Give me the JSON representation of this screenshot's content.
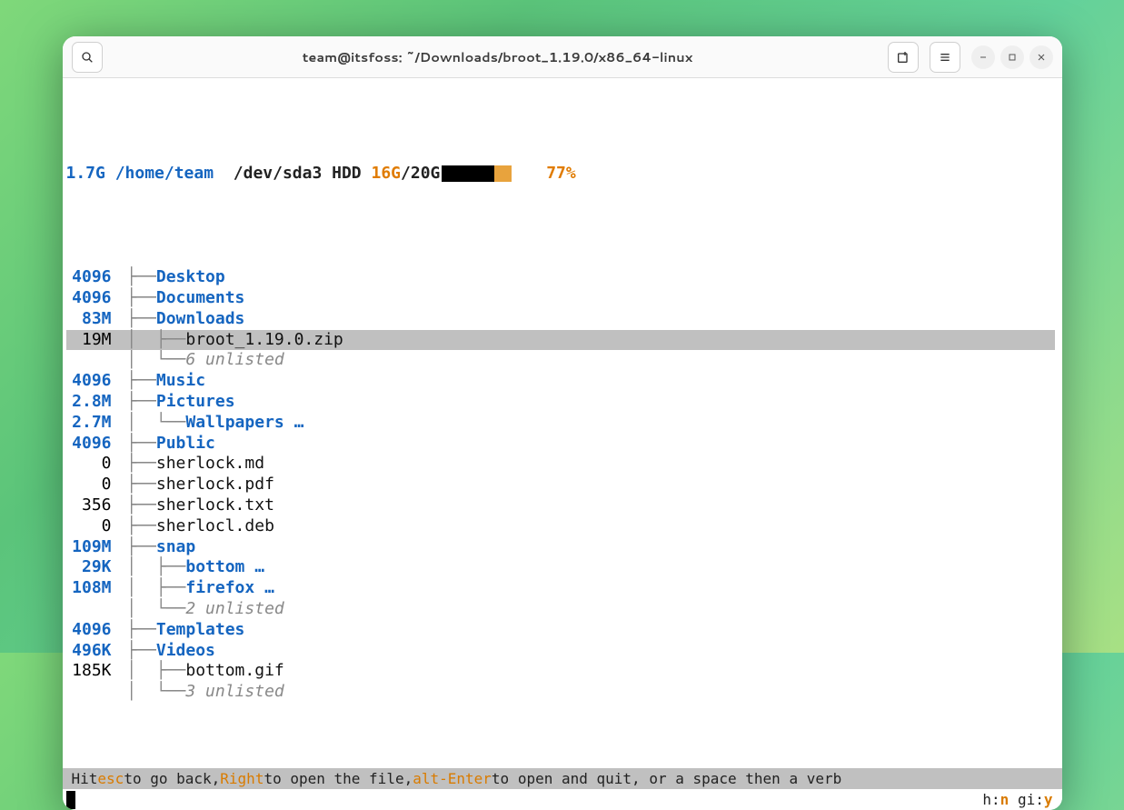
{
  "window": {
    "title": "team@itsfoss: ~/Downloads/broot_1.19.0/x86_64-linux"
  },
  "header": {
    "root_size": "1.7G",
    "root_path": "/home/team",
    "device": "/dev/sda3 HDD",
    "disk_used": "16G",
    "disk_sep": "/",
    "disk_total": "20G",
    "percent": "77%",
    "bar_used_pct": 58,
    "bar_warn_pct": 19
  },
  "tree": [
    {
      "size": "4096",
      "size_style": "blue",
      "tree": "├──",
      "name": "Desktop",
      "kind": "dir"
    },
    {
      "size": "4096",
      "size_style": "blue",
      "tree": "├──",
      "name": "Documents",
      "kind": "dir"
    },
    {
      "size": "83M",
      "size_style": "blue",
      "tree": "├──",
      "name": "Downloads",
      "kind": "dir"
    },
    {
      "size": "19M",
      "size_style": "plain",
      "tree": "│  ├──",
      "name": "broot_1.19.0.zip",
      "kind": "file",
      "selected": true
    },
    {
      "size": "",
      "size_style": "plain",
      "tree": "│  └──",
      "name": "6 unlisted",
      "kind": "unlisted"
    },
    {
      "size": "4096",
      "size_style": "blue",
      "tree": "├──",
      "name": "Music",
      "kind": "dir"
    },
    {
      "size": "2.8M",
      "size_style": "blue",
      "tree": "├──",
      "name": "Pictures",
      "kind": "dir"
    },
    {
      "size": "2.7M",
      "size_style": "blue",
      "tree": "│  └──",
      "name": "Wallpapers …",
      "kind": "dir"
    },
    {
      "size": "4096",
      "size_style": "blue",
      "tree": "├──",
      "name": "Public",
      "kind": "dir"
    },
    {
      "size": "0",
      "size_style": "plain",
      "tree": "├──",
      "name": "sherlock.md",
      "kind": "file"
    },
    {
      "size": "0",
      "size_style": "plain",
      "tree": "├──",
      "name": "sherlock.pdf",
      "kind": "file"
    },
    {
      "size": "356",
      "size_style": "plain",
      "tree": "├──",
      "name": "sherlock.txt",
      "kind": "file"
    },
    {
      "size": "0",
      "size_style": "plain",
      "tree": "├──",
      "name": "sherlocl.deb",
      "kind": "file"
    },
    {
      "size": "109M",
      "size_style": "blue",
      "tree": "├──",
      "name": "snap",
      "kind": "dir"
    },
    {
      "size": "29K",
      "size_style": "blue",
      "tree": "│  ├──",
      "name": "bottom …",
      "kind": "dir"
    },
    {
      "size": "108M",
      "size_style": "blue",
      "tree": "│  ├──",
      "name": "firefox …",
      "kind": "dir"
    },
    {
      "size": "",
      "size_style": "plain",
      "tree": "│  └──",
      "name": "2 unlisted",
      "kind": "unlisted"
    },
    {
      "size": "4096",
      "size_style": "blue",
      "tree": "├──",
      "name": "Templates",
      "kind": "dir"
    },
    {
      "size": "496K",
      "size_style": "blue",
      "tree": "├──",
      "name": "Videos",
      "kind": "dir"
    },
    {
      "size": "185K",
      "size_style": "plain",
      "tree": "│  ├──",
      "name": "bottom.gif",
      "kind": "file"
    },
    {
      "size": "",
      "size_style": "plain",
      "tree": "│  └──",
      "name": "3 unlisted",
      "kind": "unlisted"
    }
  ],
  "hint": {
    "prefix": "Hit ",
    "k1": "esc",
    "t1": " to go back, ",
    "k2": "Right",
    "t2": " to open the file, ",
    "k3": "alt-Enter",
    "t3": " to open and quit, or a space then a verb"
  },
  "flags": {
    "h_label": "h:",
    "h_val": "n",
    "gi_label": "gi:",
    "gi_val": "y"
  }
}
